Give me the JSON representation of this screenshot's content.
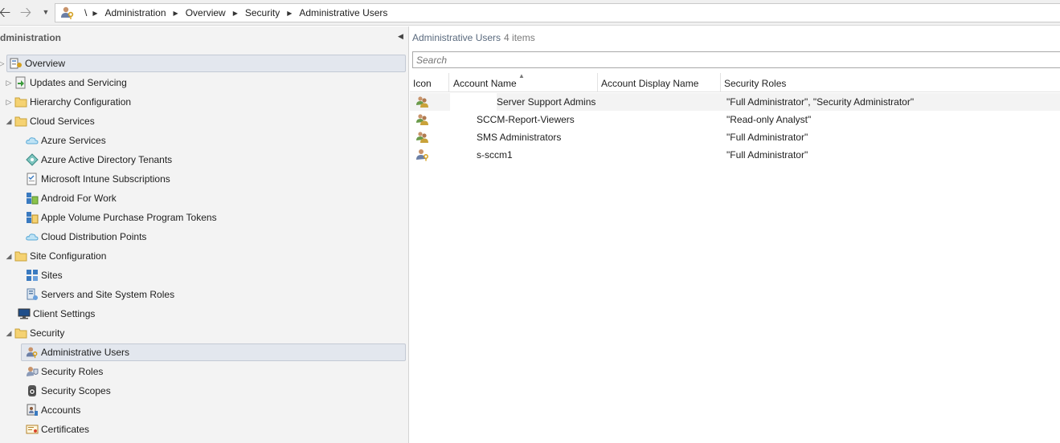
{
  "colors": {
    "selection_bg": "#e3e7ee",
    "pane_bg": "#f3f3f3",
    "folder": "#f5c84c"
  },
  "addressbar": {
    "back_icon": "arrow-left-icon",
    "forward_icon": "arrow-right-icon",
    "root": "\\",
    "crumbs": [
      "Administration",
      "Overview",
      "Security",
      "Administrative Users"
    ]
  },
  "navigation": {
    "header": "dministration",
    "items": [
      {
        "label": "Overview",
        "icon": "overview-icon"
      },
      {
        "label": "Updates and Servicing",
        "icon": "updates-icon"
      },
      {
        "label": "Hierarchy Configuration",
        "icon": "folder-icon"
      },
      {
        "label": "Cloud Services",
        "icon": "folder-icon"
      },
      {
        "label": "Azure Services",
        "icon": "cloud-icon"
      },
      {
        "label": "Azure Active Directory Tenants",
        "icon": "tenant-icon"
      },
      {
        "label": "Microsoft Intune Subscriptions",
        "icon": "document-icon"
      },
      {
        "label": "Android For Work",
        "icon": "android-icon"
      },
      {
        "label": "Apple Volume Purchase Program Tokens",
        "icon": "token-icon"
      },
      {
        "label": "Cloud Distribution Points",
        "icon": "cloud-icon"
      },
      {
        "label": "Site Configuration",
        "icon": "folder-icon"
      },
      {
        "label": "Sites",
        "icon": "sites-icon"
      },
      {
        "label": "Servers and Site System Roles",
        "icon": "server-icon"
      },
      {
        "label": "Client Settings",
        "icon": "monitor-icon"
      },
      {
        "label": "Security",
        "icon": "folder-icon"
      },
      {
        "label": "Administrative Users",
        "icon": "admin-user-icon"
      },
      {
        "label": "Security Roles",
        "icon": "security-roles-icon"
      },
      {
        "label": "Security Scopes",
        "icon": "scope-icon"
      },
      {
        "label": "Accounts",
        "icon": "accounts-icon"
      },
      {
        "label": "Certificates",
        "icon": "certificate-icon"
      }
    ],
    "selected": "Administrative Users"
  },
  "main": {
    "title": "Administrative Users",
    "count": "4 items",
    "search_placeholder": "Search",
    "columns": [
      "Icon",
      "Account Name",
      "Account Display Name",
      "Security Roles"
    ],
    "rows": [
      {
        "icon": "group-icon",
        "account": "Server Support Admins",
        "display": "",
        "roles": "\"Full Administrator\", \"Security Administrator\""
      },
      {
        "icon": "group-icon",
        "account": "SCCM-Report-Viewers",
        "display": "",
        "roles": "\"Read-only Analyst\""
      },
      {
        "icon": "group-icon",
        "account": "SMS Administrators",
        "display": "",
        "roles": "\"Full Administrator\""
      },
      {
        "icon": "user-icon",
        "account": "s-sccm1",
        "display": "",
        "roles": "\"Full Administrator\""
      }
    ]
  }
}
